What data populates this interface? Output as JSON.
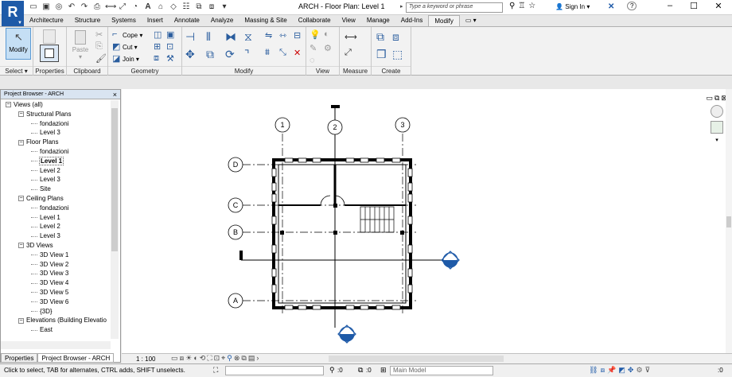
{
  "app": {
    "logo": "R",
    "window_title": "ARCH - Floor Plan: Level 1"
  },
  "search": {
    "placeholder": "Type a keyword or phrase"
  },
  "account": {
    "sign_in": "Sign In"
  },
  "ribbon_tabs": [
    "Architecture",
    "Structure",
    "Systems",
    "Insert",
    "Annotate",
    "Analyze",
    "Massing & Site",
    "Collaborate",
    "View",
    "Manage",
    "Add-Ins",
    "Modify"
  ],
  "ribbon": {
    "modify_label": "Modify",
    "paste_label": "Paste",
    "properties_label": "Properties",
    "cope_label": "Cope",
    "cut_label": "Cut",
    "join_label": "Join",
    "panels": {
      "select": "Select",
      "properties": "Properties",
      "clipboard": "Clipboard",
      "geometry": "Geometry",
      "modify": "Modify",
      "view": "View",
      "measure": "Measure",
      "create": "Create"
    }
  },
  "project_browser": {
    "title": "Project Browser - ARCH",
    "close": "×",
    "items": [
      {
        "label": "Views (all)",
        "level": 0,
        "toggle": "−"
      },
      {
        "label": "Structural Plans",
        "level": 1,
        "toggle": "−"
      },
      {
        "label": "fondazioni",
        "level": 2
      },
      {
        "label": "Level 3",
        "level": 2
      },
      {
        "label": "Floor Plans",
        "level": 1,
        "toggle": "−"
      },
      {
        "label": "fondazioni",
        "level": 2
      },
      {
        "label": "Level 1",
        "level": 2,
        "selected": true
      },
      {
        "label": "Level 2",
        "level": 2
      },
      {
        "label": "Level 3",
        "level": 2
      },
      {
        "label": "Site",
        "level": 2
      },
      {
        "label": "Ceiling Plans",
        "level": 1,
        "toggle": "−"
      },
      {
        "label": "fondazioni",
        "level": 2
      },
      {
        "label": "Level 1",
        "level": 2
      },
      {
        "label": "Level 2",
        "level": 2
      },
      {
        "label": "Level 3",
        "level": 2
      },
      {
        "label": "3D Views",
        "level": 1,
        "toggle": "−"
      },
      {
        "label": "3D View 1",
        "level": 2
      },
      {
        "label": "3D View 2",
        "level": 2
      },
      {
        "label": "3D View 3",
        "level": 2
      },
      {
        "label": "3D View 4",
        "level": 2
      },
      {
        "label": "3D View 5",
        "level": 2
      },
      {
        "label": "3D View 6",
        "level": 2
      },
      {
        "label": "{3D}",
        "level": 2
      },
      {
        "label": "Elevations (Building Elevatio",
        "level": 1,
        "toggle": "−"
      },
      {
        "label": "East",
        "level": 2
      }
    ],
    "bottom_tabs": [
      "Properties",
      "Project Browser - ARCH"
    ]
  },
  "drawing": {
    "grid_numbers": [
      "1",
      "2",
      "3"
    ],
    "grid_letters": [
      "D",
      "C",
      "B",
      "A"
    ]
  },
  "view_control": {
    "scale": "1 : 100"
  },
  "status": {
    "message": "Click to select, TAB for alternates, CTRL adds, SHIFT unselects.",
    "count_a": ":0",
    "count_b": ":0",
    "model": "Main Model",
    "filter_count": ":0"
  }
}
